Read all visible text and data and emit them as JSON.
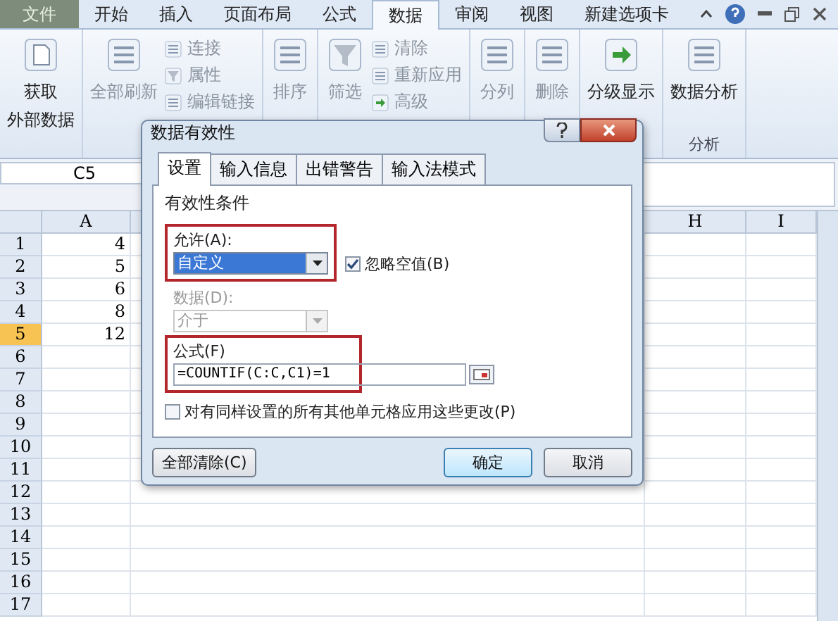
{
  "ribbon_tabs": [
    {
      "label": "文件",
      "selected": false,
      "kind": "file"
    },
    {
      "label": "开始",
      "selected": false,
      "kind": "tab"
    },
    {
      "label": "插入",
      "selected": false,
      "kind": "tab"
    },
    {
      "label": "页面布局",
      "selected": false,
      "kind": "tab"
    },
    {
      "label": "公式",
      "selected": false,
      "kind": "tab"
    },
    {
      "label": "数据",
      "selected": true,
      "kind": "tab"
    },
    {
      "label": "审阅",
      "selected": false,
      "kind": "tab"
    },
    {
      "label": "视图",
      "selected": false,
      "kind": "tab"
    },
    {
      "label": "新建选项卡",
      "selected": false,
      "kind": "tab"
    }
  ],
  "ribbon_groups": [
    {
      "large": {
        "lines": [
          "获取",
          "外部数据"
        ],
        "disabled": false
      }
    },
    {
      "large": {
        "lines": [
          "全部刷新"
        ],
        "disabled": true
      },
      "small": [
        {
          "label": "连接",
          "disabled": true
        },
        {
          "label": "属性",
          "disabled": true
        },
        {
          "label": "编辑链接",
          "disabled": true
        }
      ]
    },
    {
      "large": {
        "lines": [
          "排序"
        ],
        "disabled": true
      }
    },
    {
      "large": {
        "lines": [
          "筛选"
        ],
        "disabled": true
      },
      "small": [
        {
          "label": "清除",
          "disabled": true
        },
        {
          "label": "重新应用",
          "disabled": true
        },
        {
          "label": "高级",
          "disabled": true
        }
      ]
    },
    {
      "large": {
        "lines": [
          "分列"
        ],
        "disabled": true
      }
    },
    {
      "large": {
        "lines": [
          "删除"
        ],
        "disabled": true
      }
    },
    {
      "large": {
        "lines": [
          "分级显示"
        ],
        "disabled": false
      }
    },
    {
      "large": {
        "lines": [
          "数据分析"
        ],
        "disabled": false
      },
      "group_label": "分析"
    }
  ],
  "name_box": "C5",
  "columns": [
    {
      "label": "A",
      "kind": "left"
    },
    {
      "label": "H",
      "kind": "right"
    },
    {
      "label": "I",
      "kind": "right"
    }
  ],
  "rows": [
    {
      "number": "1",
      "a": "4",
      "selected": false
    },
    {
      "number": "2",
      "a": "5",
      "selected": false
    },
    {
      "number": "3",
      "a": "6",
      "selected": false
    },
    {
      "number": "4",
      "a": "8",
      "selected": false
    },
    {
      "number": "5",
      "a": "12",
      "selected": true
    },
    {
      "number": "6",
      "selected": false
    },
    {
      "number": "7",
      "selected": false
    },
    {
      "number": "8",
      "selected": false
    },
    {
      "number": "9",
      "selected": false
    },
    {
      "number": "10",
      "selected": false
    },
    {
      "number": "11",
      "selected": false
    },
    {
      "number": "12",
      "selected": false
    },
    {
      "number": "13",
      "selected": false
    },
    {
      "number": "14",
      "selected": false
    },
    {
      "number": "15",
      "selected": false
    },
    {
      "number": "16",
      "selected": false
    },
    {
      "number": "17",
      "selected": false
    }
  ],
  "dialog": {
    "title": "数据有效性",
    "tabs": [
      {
        "label": "设置",
        "selected": true
      },
      {
        "label": "输入信息",
        "selected": false
      },
      {
        "label": "出错警告",
        "selected": false
      },
      {
        "label": "输入法模式",
        "selected": false
      }
    ],
    "section": "有效性条件",
    "allow": {
      "label": "允许(A):",
      "value": "自定义"
    },
    "ignore_blank": {
      "label": "忽略空值(B)",
      "checked": true
    },
    "data": {
      "label": "数据(D):",
      "value": "介于",
      "disabled": true
    },
    "formula": {
      "label": "公式(F)",
      "value": "=COUNTIF(C:C,C1)=1"
    },
    "apply_all": {
      "label": "对有同样设置的所有其他单元格应用这些更改(P)",
      "checked": false
    },
    "buttons": [
      {
        "label": "全部清除(C)",
        "kind": "left"
      },
      {
        "label": "确定",
        "kind": "default"
      },
      {
        "label": "取消",
        "kind": "normal"
      }
    ]
  }
}
